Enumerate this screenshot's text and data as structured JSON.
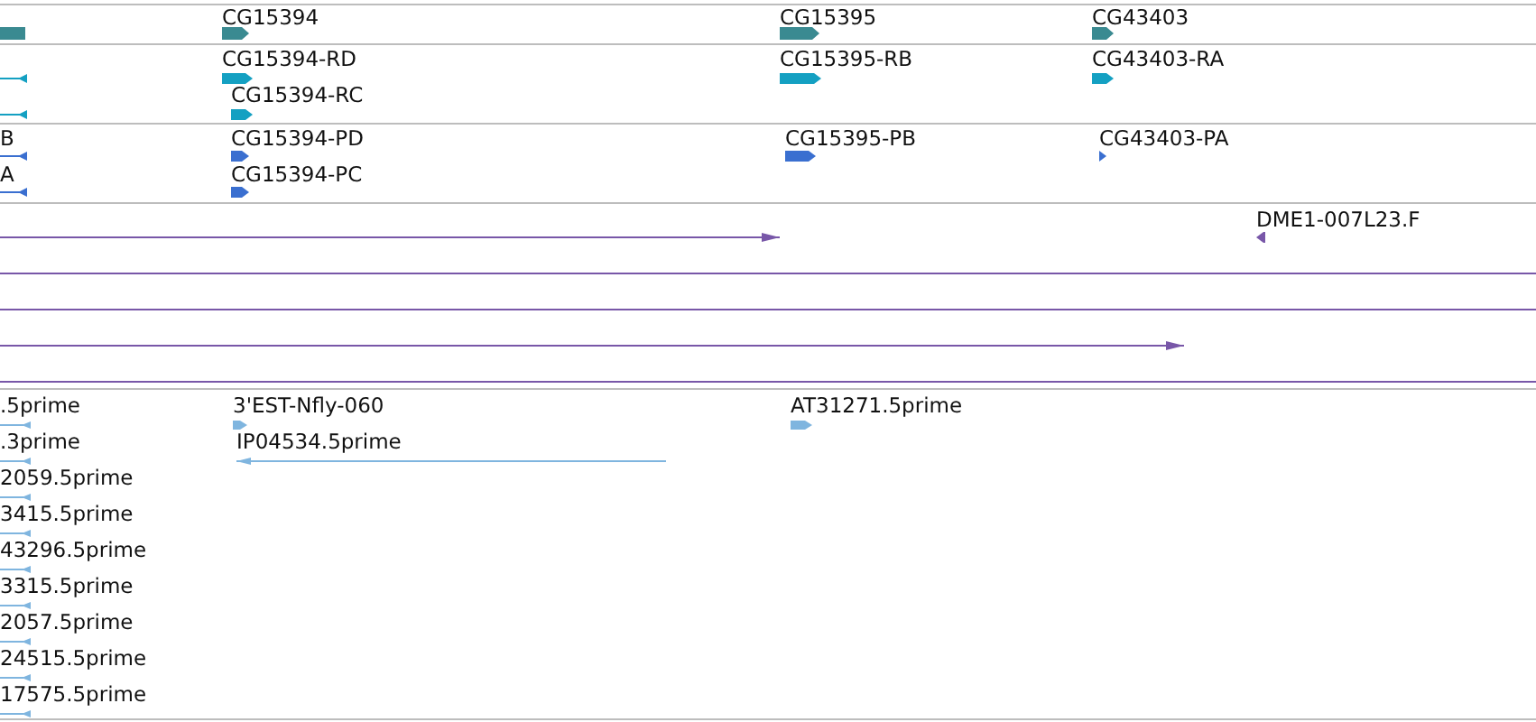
{
  "tracks": [
    {
      "kind": "gene",
      "features": [
        {
          "clipped": true
        },
        {
          "label": "CG15394",
          "reverse": false
        },
        {
          "label": "CG15395",
          "reverse": false
        },
        {
          "label": "CG43403",
          "reverse": false
        }
      ]
    },
    {
      "kind": "transcript",
      "features": [
        {
          "reverse": true
        },
        {
          "reverse": true
        },
        {
          "label": "CG15394-RD",
          "reverse": false
        },
        {
          "label": "CG15394-RC",
          "reverse": false
        },
        {
          "label": "CG15395-RB",
          "reverse": false
        },
        {
          "label": "CG43403-RA",
          "reverse": false
        }
      ]
    },
    {
      "kind": "protein",
      "features": [
        {
          "label": "B",
          "reverse": true
        },
        {
          "label": "A",
          "reverse": true
        },
        {
          "label": "CG15394-PD",
          "reverse": false
        },
        {
          "label": "CG15394-PC",
          "reverse": false
        },
        {
          "label": "CG15395-PB",
          "reverse": false
        },
        {
          "label": "CG43403-PA",
          "reverse": false
        }
      ]
    },
    {
      "kind": "alignment",
      "features": [
        {
          "reverse": false
        },
        {
          "label": "DME1-007L23.F",
          "reverse": true
        },
        {
          "clipped": true
        },
        {
          "clipped": true
        },
        {
          "reverse": false
        },
        {
          "clipped": true
        }
      ]
    },
    {
      "kind": "est",
      "features": [
        {
          "label": ".5prime",
          "reverse": true
        },
        {
          "label": ".3prime",
          "reverse": true
        },
        {
          "label": "2059.5prime",
          "reverse": true
        },
        {
          "label": "3415.5prime",
          "reverse": true
        },
        {
          "label": "43296.5prime",
          "reverse": true
        },
        {
          "label": "3315.5prime",
          "reverse": true
        },
        {
          "label": "2057.5prime",
          "reverse": true
        },
        {
          "label": "24515.5prime",
          "reverse": true
        },
        {
          "label": "17575.5prime",
          "reverse": true
        },
        {
          "label": "3'EST-Nfly-060",
          "reverse": false
        },
        {
          "label": "IP04534.5prime",
          "reverse": true
        },
        {
          "label": "AT31271.5prime",
          "reverse": false
        }
      ]
    }
  ]
}
